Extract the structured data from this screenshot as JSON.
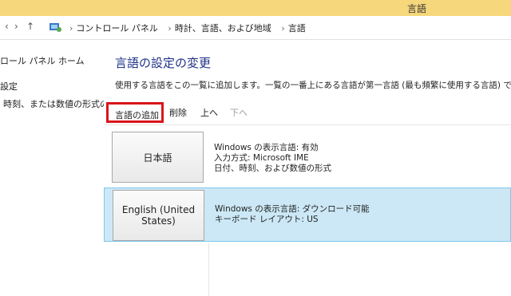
{
  "window": {
    "title": "言語"
  },
  "address": {
    "crumbs": [
      "コントロール パネル",
      "時計、言語、および地域",
      "言語"
    ]
  },
  "sidebar": {
    "items": [
      {
        "label": "ロール パネル ホーム"
      },
      {
        "label": "設定"
      },
      {
        "label": "時刻、または数値の形式の"
      }
    ]
  },
  "main": {
    "heading": "言語の設定の変更",
    "description": "使用する言語をこの一覧に追加します。一覧の一番上にある言語が第一言語 (最も頻繁に使用する言語) です。"
  },
  "toolbar": {
    "add_label": "言語の追加",
    "remove_label": "削除",
    "up_label": "上へ",
    "down_label": "下へ"
  },
  "languages": [
    {
      "name": "日本語",
      "lines": [
        "Windows の表示言語: 有効",
        "入力方式: Microsoft IME",
        "日付、時刻、および数値の形式"
      ]
    },
    {
      "name": "English (United States)",
      "lines": [
        "Windows の表示言語: ダウンロード可能",
        "キーボード レイアウト: US"
      ]
    }
  ],
  "colors": {
    "titlebar": "#f6d77b",
    "heading": "#1e3287",
    "highlight": "#d9151b",
    "selected_row": "#cce8f6"
  }
}
